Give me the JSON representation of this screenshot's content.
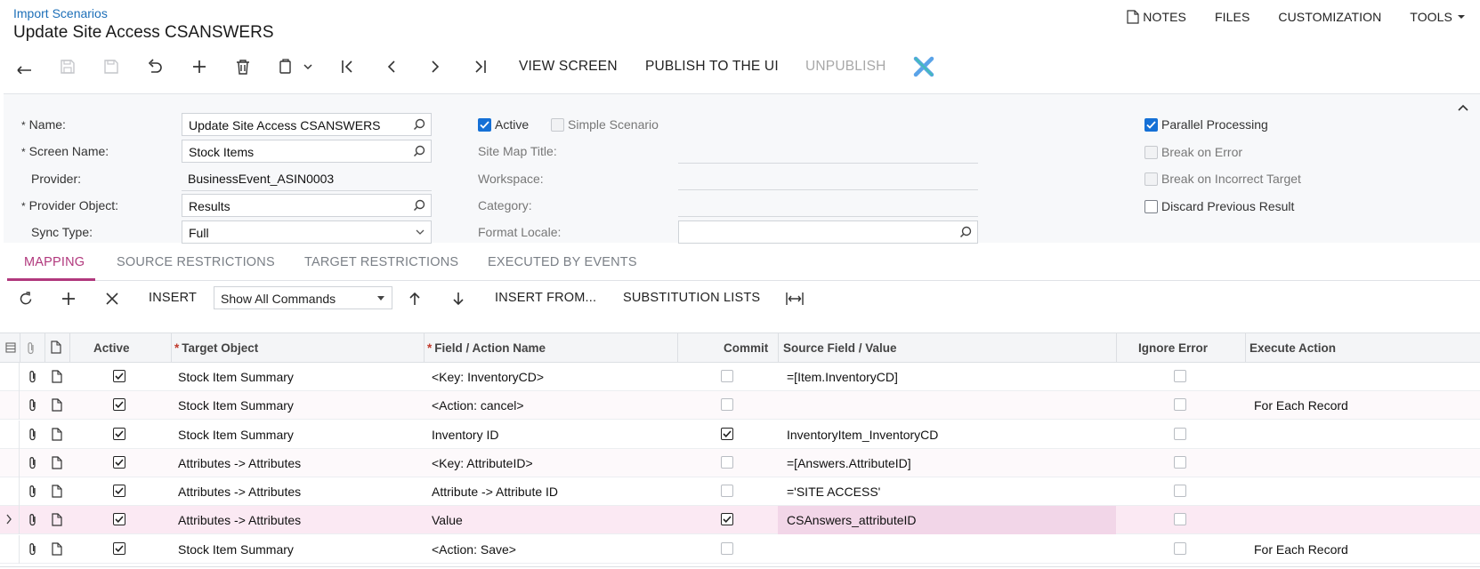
{
  "header": {
    "breadcrumb": "Import Scenarios",
    "title": "Update Site Access CSANSWERS",
    "menu": {
      "notes": "NOTES",
      "files": "FILES",
      "customization": "CUSTOMIZATION",
      "tools": "TOOLS"
    }
  },
  "toolbar": {
    "icons": [
      "back-icon",
      "save-close-icon",
      "save-icon",
      "undo-icon",
      "add-icon",
      "delete-icon",
      "copy-icon",
      "first-icon",
      "prev-icon",
      "next-icon",
      "last-icon",
      "puzzle-icon"
    ],
    "view_screen": "VIEW SCREEN",
    "publish": "PUBLISH TO THE UI",
    "unpublish": "UNPUBLISH"
  },
  "form": {
    "name_label": "Name:",
    "name_value": "Update Site Access CSANSWERS",
    "screen_name_label": "Screen Name:",
    "screen_name_value": "Stock Items",
    "provider_label": "Provider:",
    "provider_value": "BusinessEvent_ASIN0003",
    "provider_object_label": "Provider Object:",
    "provider_object_value": "Results",
    "sync_type_label": "Sync Type:",
    "sync_type_value": "Full",
    "active_label": "Active",
    "simple_scenario_label": "Simple Scenario",
    "site_map_title_label": "Site Map Title:",
    "workspace_label": "Workspace:",
    "category_label": "Category:",
    "format_locale_label": "Format Locale:",
    "parallel_processing_label": "Parallel Processing",
    "break_on_error_label": "Break on Error",
    "break_on_incorrect_target_label": "Break on Incorrect Target",
    "discard_previous_result_label": "Discard Previous Result"
  },
  "tabs": [
    "MAPPING",
    "SOURCE RESTRICTIONS",
    "TARGET RESTRICTIONS",
    "EXECUTED BY EVENTS"
  ],
  "grid_toolbar": {
    "insert": "INSERT",
    "show_commands": "Show All Commands",
    "insert_from": "INSERT FROM...",
    "substitution_lists": "SUBSTITUTION LISTS"
  },
  "columns": {
    "active": "Active",
    "target_object": "Target Object",
    "field_action": "Field / Action Name",
    "commit": "Commit",
    "source_field": "Source Field / Value",
    "ignore_error": "Ignore Error",
    "execute_action": "Execute Action"
  },
  "rows": [
    {
      "target": "Stock Item Summary",
      "field": "<Key: InventoryCD>",
      "source": "=[Item.InventoryCD]",
      "execute": ""
    },
    {
      "target": "Stock Item Summary",
      "field": "<Action: cancel>",
      "source": "",
      "execute": "For Each Record"
    },
    {
      "target": "Stock Item Summary",
      "field": "Inventory ID",
      "source": "InventoryItem_InventoryCD",
      "execute": ""
    },
    {
      "target": "Attributes -> Attributes",
      "field": "<Key: AttributeID>",
      "source": "=[Answers.AttributeID]",
      "execute": ""
    },
    {
      "target": "Attributes -> Attributes",
      "field": "Attribute -> Attribute ID",
      "source": "='SITE ACCESS'",
      "execute": ""
    },
    {
      "target": "Attributes -> Attributes",
      "field": "Value",
      "source": "CSAnswers_attributeID",
      "execute": ""
    },
    {
      "target": "Stock Item Summary",
      "field": "<Action: Save>",
      "source": "",
      "execute": "For Each Record"
    }
  ]
}
